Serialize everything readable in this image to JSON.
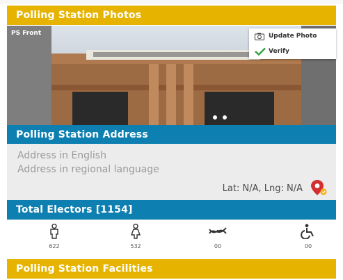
{
  "photos": {
    "header": "Polling Station Photos",
    "caption": "PS Front",
    "menu": [
      {
        "label": "Update Photo",
        "icon": "camera-icon"
      },
      {
        "label": "Verify",
        "icon": "check-icon"
      }
    ]
  },
  "address": {
    "header": "Polling Station Address",
    "english_placeholder": "Address in English",
    "regional_placeholder": "Address in regional language",
    "latlng": "Lat: N/A, Lng: N/A",
    "pin_icon": "map-pin-icon"
  },
  "electors": {
    "header": "Total Electors [1154]",
    "items": [
      {
        "icon": "male-icon",
        "count": "622"
      },
      {
        "icon": "female-icon",
        "count": "532"
      },
      {
        "icon": "third-gender-icon",
        "count": "00"
      },
      {
        "icon": "disabled-icon",
        "count": "00"
      }
    ]
  },
  "facilities": {
    "header": "Polling Station Facilities"
  },
  "colors": {
    "yellow": "#e6b400",
    "blue": "#0d7fb0",
    "verify_green": "#2e9e3e",
    "pin_red": "#d32f2f"
  }
}
